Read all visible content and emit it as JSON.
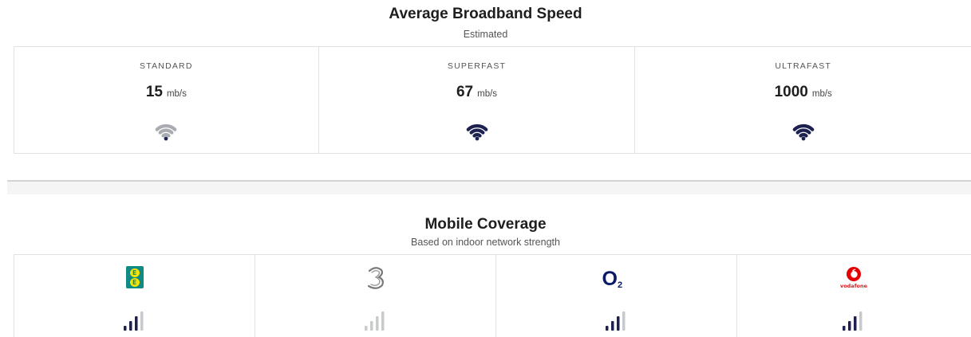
{
  "broadband": {
    "title": "Average Broadband Speed",
    "subtitle": "Estimated",
    "tiers": [
      {
        "label": "STANDARD",
        "speed": "15",
        "unit": "mb/s",
        "wifi_color": "#a9acb0",
        "dot_color": "#1c2150"
      },
      {
        "label": "SUPERFAST",
        "speed": "67",
        "unit": "mb/s",
        "wifi_color": "#1c2150",
        "dot_color": "#1c2150"
      },
      {
        "label": "ULTRAFAST",
        "speed": "1000",
        "unit": "mb/s",
        "wifi_color": "#1c2150",
        "dot_color": "#1c2150"
      }
    ]
  },
  "mobile": {
    "title": "Mobile Coverage",
    "subtitle": "Based on indoor network strength",
    "operators": [
      {
        "name": "EE",
        "logo_text": "E E",
        "signal_bars": 3,
        "dim": false
      },
      {
        "name": "Three",
        "logo_text": "3",
        "signal_bars": 3,
        "dim": true
      },
      {
        "name": "O2",
        "logo_text": "O",
        "logo_sub": "2",
        "signal_bars": 3,
        "dim": false
      },
      {
        "name": "Vodafone",
        "logo_text": "vodafone",
        "signal_bars": 3,
        "dim": false
      }
    ],
    "colors": {
      "bar_active": "#1c2150",
      "bar_inactive": "#c7c9cc",
      "dim_bar": "#c8cbcc"
    }
  }
}
